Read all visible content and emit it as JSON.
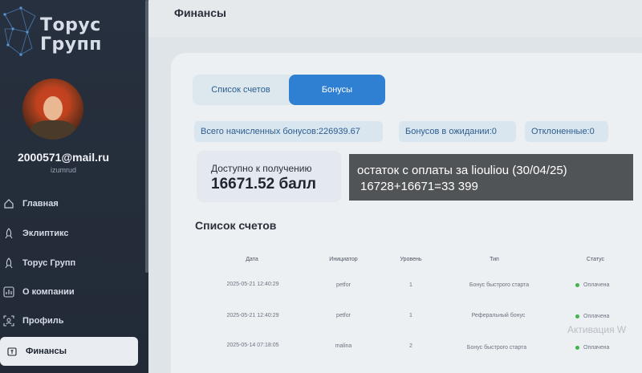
{
  "sidebar": {
    "logo_line1": "Торус",
    "logo_line2": "Групп",
    "user_email": "2000571@mail.ru",
    "user_nick": "izumrud",
    "nav": [
      {
        "label": "Главная",
        "icon": "home-icon"
      },
      {
        "label": "Эклиптикс",
        "icon": "rocket-icon"
      },
      {
        "label": "Торус Групп",
        "icon": "rocket-icon"
      },
      {
        "label": "О компании",
        "icon": "chart-icon"
      },
      {
        "label": "Профиль",
        "icon": "user-icon"
      },
      {
        "label": "Финансы",
        "icon": "wallet-icon"
      }
    ],
    "active_nav": "Финансы"
  },
  "header": {
    "title": "Финансы"
  },
  "tabs": [
    {
      "label": "Список счетов",
      "active": false
    },
    {
      "label": "Бонусы",
      "active": true
    }
  ],
  "stats": {
    "total": "Всего начисленных бонусов:226939.67",
    "pending": "Бонусов в ожидании:0",
    "rejected": "Отклоненные:0"
  },
  "available": {
    "label": "Доступно к получению",
    "value": "16671.52 балл"
  },
  "section_title": "Список счетов",
  "table": {
    "columns": [
      "Дата",
      "Инициатор",
      "Уровень",
      "Тип",
      "Статус"
    ],
    "rows": [
      {
        "date": "2025-05-21 12:40:29",
        "initiator": "petfor",
        "level": "1",
        "type": "Бонус быстрого старта",
        "status": "Оплачена"
      },
      {
        "date": "2025-05-21 12:40:29",
        "initiator": "petfor",
        "level": "1",
        "type": "Реферальный бонус",
        "status": "Оплачена"
      },
      {
        "date": "2025-05-14 07:18:05",
        "initiator": "malina",
        "level": "2",
        "type": "Бонус быстрого старта",
        "status": "Оплачена"
      }
    ]
  },
  "watermark": "Активация W",
  "note": {
    "line1": "остаток с оплаты за liouliou (30/04/25)",
    "line2": "16728+16671=33 399"
  },
  "colors": {
    "sidebar_bg": "#27303e",
    "accent": "#2f7fd3",
    "chip_bg": "#d9e6ef",
    "status_green": "#3fb54c",
    "note_bg": "#515457"
  }
}
